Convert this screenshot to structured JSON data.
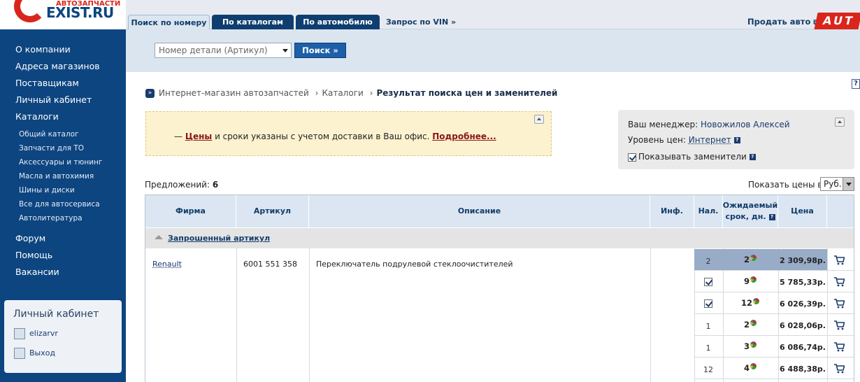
{
  "logo": {
    "sub": "АВТОЗАПЧАСТИ",
    "main": "EXIST.RU"
  },
  "sidebar": {
    "main_items": [
      {
        "label": "О компании"
      },
      {
        "label": "Адреса магазинов"
      },
      {
        "label": "Поставщикам"
      },
      {
        "label": "Личный кабинет"
      },
      {
        "label": "Каталоги"
      }
    ],
    "catalog_items": [
      {
        "label": "Общий каталог"
      },
      {
        "label": "Запчасти для ТО"
      },
      {
        "label": "Аксессуары и тюнинг"
      },
      {
        "label": "Масла и автохимия"
      },
      {
        "label": "Шины и диски"
      },
      {
        "label": "Все для автосервиса"
      },
      {
        "label": "Автолитература"
      }
    ],
    "bottom_items": [
      {
        "label": "Форум"
      },
      {
        "label": "Помощь"
      },
      {
        "label": "Вакансии"
      }
    ],
    "account_box": {
      "title": "Личный кабинет",
      "user": "elizarvr",
      "logout": "Выход"
    }
  },
  "tabs": [
    {
      "label": "Поиск по номеру"
    },
    {
      "label": "По каталогам"
    },
    {
      "label": "По автомобилю"
    },
    {
      "label": "Запрос по VIN »"
    }
  ],
  "header": {
    "sell_link": "Продать авто",
    "auto_strip": "AUT"
  },
  "search": {
    "select_value": "Номер детали (Артикул)",
    "button": "Поиск »"
  },
  "breadcrumb": {
    "home": "Интернет-магазин автозапчастей",
    "catalogs": "Каталоги",
    "current": "Результат поиска цен и заменителей"
  },
  "notice": {
    "dash": "— ",
    "prices": "Цены",
    "text": " и сроки указаны с учетом доставки в Ваш офис. ",
    "more": "Подробнее..."
  },
  "manager_box": {
    "manager_label": "Ваш менеджер: ",
    "manager_name": "Новожилов Алексей",
    "price_level_label": "Уровень цен: ",
    "price_level_value": "Интернет",
    "show_substitutes": "Показывать заменители"
  },
  "offers": {
    "label": "Предложений: ",
    "count": "6"
  },
  "currency": {
    "label": "Показать цены в",
    "value": "Руб."
  },
  "table": {
    "headers": {
      "firm": "Фирма",
      "article": "Артикул",
      "description": "Описание",
      "info": "Инф.",
      "avail": "Нал.",
      "expected_1": "Ожидаемый",
      "expected_2": "срок, дн.",
      "price": "Цена"
    },
    "group_label": "Запрошенный артикул",
    "item": {
      "firm": "Renault",
      "article": "6001 551 358",
      "description": "Переключатель подрулевой стеклоочистителей"
    },
    "offers": [
      {
        "qty": "2",
        "checkbox": false,
        "days": "2",
        "price": "2 309,98р."
      },
      {
        "qty": "",
        "checkbox": true,
        "days": "9",
        "price": "5 785,33р."
      },
      {
        "qty": "",
        "checkbox": true,
        "days": "12",
        "price": "6 026,39р."
      },
      {
        "qty": "1",
        "checkbox": false,
        "days": "2",
        "price": "6 028,06р."
      },
      {
        "qty": "1",
        "checkbox": false,
        "days": "3",
        "price": "6 086,74р."
      },
      {
        "qty": "12",
        "checkbox": false,
        "days": "4",
        "price": "6 488,38р."
      }
    ]
  }
}
